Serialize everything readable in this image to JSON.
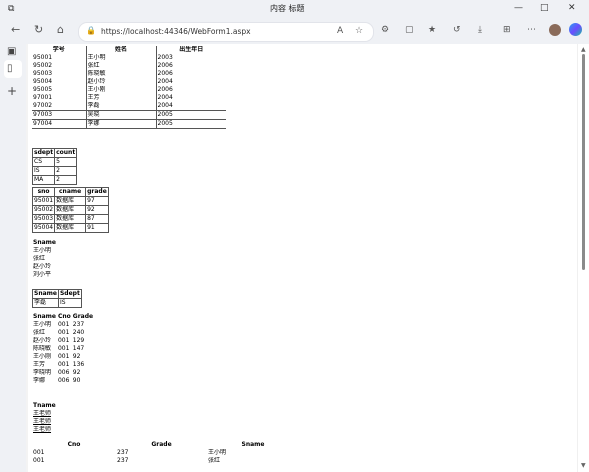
{
  "window": {
    "title": "内容 标题",
    "min_glyph": "—",
    "max_glyph": "□",
    "close_glyph": "✕"
  },
  "address": {
    "url": "https://localhost:44346/WebForm1.aspx"
  },
  "grid1": {
    "headers": [
      "学号",
      "姓名",
      "出生年日"
    ],
    "rows": [
      [
        "95001",
        "王小明",
        "2003"
      ],
      [
        "95002",
        "张红",
        "2006"
      ],
      [
        "95003",
        "陈晓敏",
        "2006"
      ],
      [
        "95004",
        "赵小玲",
        "2004"
      ],
      [
        "95005",
        "王小刚",
        "2006"
      ],
      [
        "97001",
        "王芳",
        "2004"
      ],
      [
        "97002",
        "李磊",
        "2004"
      ],
      [
        "97003",
        "吴晓",
        "2005"
      ],
      [
        "97004",
        "李娜",
        "2005"
      ]
    ]
  },
  "grid2": {
    "headers": [
      "sdept",
      "count"
    ],
    "rows": [
      [
        "CS",
        "5"
      ],
      [
        "IS",
        "2"
      ],
      [
        "MA",
        "2"
      ]
    ]
  },
  "grid3": {
    "headers": [
      "sno",
      "cname",
      "grade"
    ],
    "rows": [
      [
        "95001",
        "数据库",
        "97"
      ],
      [
        "95002",
        "数据库",
        "92"
      ],
      [
        "95003",
        "数据库",
        "87"
      ],
      [
        "95004",
        "数据库",
        "91"
      ]
    ]
  },
  "grid4": {
    "headers": [
      "Sname"
    ],
    "rows": [
      [
        "王小明"
      ],
      [
        "张红"
      ],
      [
        "赵小玲"
      ],
      [
        "刘小平"
      ]
    ]
  },
  "grid5": {
    "headers": [
      "Sname",
      "Sdept"
    ],
    "rows": [
      [
        "李磊",
        "IS"
      ]
    ]
  },
  "grid6": {
    "headers": [
      "Sname",
      "Cno",
      "Grade"
    ],
    "rows": [
      [
        "王小明",
        "001",
        "237"
      ],
      [
        "张红",
        "001",
        "240"
      ],
      [
        "赵小玲",
        "001",
        "129"
      ],
      [
        "陈晓敏",
        "001",
        "147"
      ],
      [
        "王小刚",
        "001",
        "92"
      ],
      [
        "王芳",
        "001",
        "136"
      ],
      [
        "李晓明",
        "006",
        "92"
      ],
      [
        "李娜",
        "006",
        "90"
      ]
    ]
  },
  "grid7": {
    "headers": [
      "Tname"
    ],
    "rows": [
      [
        "王老师"
      ],
      [
        "王老师"
      ],
      [
        "王老师"
      ]
    ]
  },
  "grid8": {
    "headers": [
      "Cno",
      "Grade",
      "Sname"
    ],
    "rows": [
      [
        "001",
        "237",
        "王小明"
      ],
      [
        "001",
        "237",
        "张红"
      ]
    ]
  }
}
